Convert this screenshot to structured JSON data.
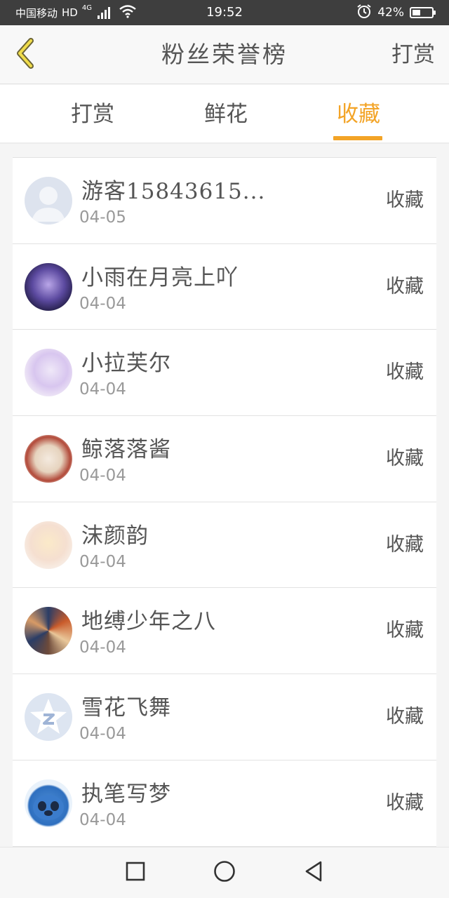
{
  "status_bar": {
    "carrier": "中国移动",
    "hd": "HD",
    "network": "4G",
    "time": "19:52",
    "battery": "42%",
    "battery_level": 0.42
  },
  "header": {
    "title": "粉丝荣誉榜",
    "action": "打赏",
    "back_icon": "chevron-left-icon",
    "accent_color": "#f3a427"
  },
  "tabs": [
    {
      "label": "打赏",
      "active": false
    },
    {
      "label": "鲜花",
      "active": false
    },
    {
      "label": "收藏",
      "active": true
    }
  ],
  "items": [
    {
      "name": "游客15843615...",
      "date": "04-05",
      "action": "收藏",
      "avatar": "default-avatar"
    },
    {
      "name": "小雨在月亮上吖",
      "date": "04-04",
      "action": "收藏",
      "avatar": "anime-avatar"
    },
    {
      "name": "小拉芙尔",
      "date": "04-04",
      "action": "收藏",
      "avatar": "anime-avatar"
    },
    {
      "name": "鲸落落酱",
      "date": "04-04",
      "action": "收藏",
      "avatar": "anime-avatar"
    },
    {
      "name": "沫颜韵",
      "date": "04-04",
      "action": "收藏",
      "avatar": "anime-avatar"
    },
    {
      "name": "地缚少年之八",
      "date": "04-04",
      "action": "收藏",
      "avatar": "anime-avatar"
    },
    {
      "name": "雪花飞舞",
      "date": "04-04",
      "action": "收藏",
      "avatar": "qq-avatar"
    },
    {
      "name": "执笔写梦",
      "date": "04-04",
      "action": "收藏",
      "avatar": "stitch-avatar"
    }
  ],
  "navbar": {
    "recents_icon": "square-icon",
    "home_icon": "circle-icon",
    "back_icon": "triangle-back-icon"
  }
}
